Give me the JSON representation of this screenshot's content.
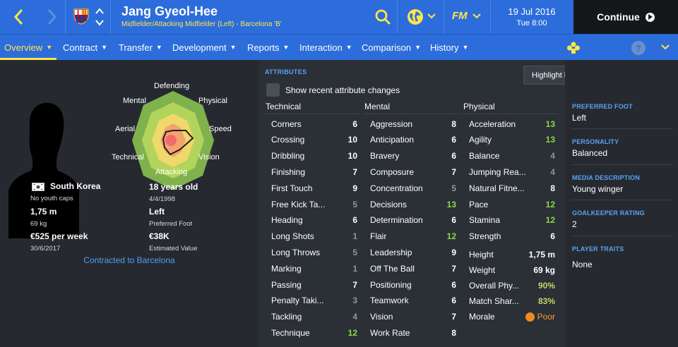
{
  "header": {
    "player_name": "Jang Gyeol-Hee",
    "player_subtitle": "Midfielder/Attacking Midfielder (Left) - Barcelona 'B'",
    "game_logo": "FM",
    "date": "19 Jul 2016",
    "time": "Tue 8:00",
    "continue_label": "Continue",
    "icons": [
      "back-arrow-icon",
      "forward-arrow-icon",
      "club-crest-icon",
      "up-down-icon",
      "search-icon",
      "globe-icon",
      "chevron-down-icon",
      "play-icon"
    ],
    "accent_color": "#2d6ddb",
    "highlight_color": "#ffe64a"
  },
  "subnav": {
    "tabs": [
      {
        "label": "Overview"
      },
      {
        "label": "Contract"
      },
      {
        "label": "Transfer"
      },
      {
        "label": "Development"
      },
      {
        "label": "Reports"
      },
      {
        "label": "Interaction"
      },
      {
        "label": "Comparison"
      },
      {
        "label": "History"
      }
    ],
    "active_tab": "Overview",
    "help_label": "?",
    "icons": [
      "trophy-icon",
      "help-icon",
      "chevron-down-icon"
    ]
  },
  "radar": {
    "labels": {
      "defending": "Defending",
      "physical": "Physical",
      "speed": "Speed",
      "vision": "Vision",
      "attacking": "Attacking",
      "technical": "Technical",
      "aerial": "Aerial",
      "mental": "Mental"
    }
  },
  "bio": {
    "nationality": "South Korea",
    "youth_caps": "No youth caps",
    "height": "1,75 m",
    "weight": "69 kg",
    "wage": "€525 per week",
    "contract_end": "30/6/2017",
    "age": "18 years old",
    "dob": "4/4/1998",
    "foot": "Left",
    "foot_label": "Preferred Foot",
    "value": "€38K",
    "value_label": "Estimated Value",
    "contracted": "Contracted to Barcelona"
  },
  "attributes": {
    "title": "ATTRIBUTES",
    "highlight_dropdown": "Highlight key attributes for role",
    "show_recent_label": "Show recent attribute changes",
    "columns": [
      {
        "heading": "Technical",
        "items": [
          {
            "name": "Corners",
            "value": "6",
            "tier": "good"
          },
          {
            "name": "Crossing",
            "value": "10",
            "tier": "good"
          },
          {
            "name": "Dribbling",
            "value": "10",
            "tier": "good"
          },
          {
            "name": "Finishing",
            "value": "7",
            "tier": "good"
          },
          {
            "name": "First Touch",
            "value": "9",
            "tier": "good"
          },
          {
            "name": "Free Kick Ta...",
            "value": "5",
            "tier": "avg"
          },
          {
            "name": "Heading",
            "value": "6",
            "tier": "good"
          },
          {
            "name": "Long Shots",
            "value": "1",
            "tier": "avg"
          },
          {
            "name": "Long Throws",
            "value": "5",
            "tier": "avg"
          },
          {
            "name": "Marking",
            "value": "1",
            "tier": "avg"
          },
          {
            "name": "Passing",
            "value": "7",
            "tier": "good"
          },
          {
            "name": "Penalty Taki...",
            "value": "3",
            "tier": "avg"
          },
          {
            "name": "Tackling",
            "value": "4",
            "tier": "avg"
          },
          {
            "name": "Technique",
            "value": "12",
            "tier": "high"
          }
        ]
      },
      {
        "heading": "Mental",
        "items": [
          {
            "name": "Aggression",
            "value": "8",
            "tier": "good"
          },
          {
            "name": "Anticipation",
            "value": "6",
            "tier": "good"
          },
          {
            "name": "Bravery",
            "value": "6",
            "tier": "good"
          },
          {
            "name": "Composure",
            "value": "7",
            "tier": "good"
          },
          {
            "name": "Concentration",
            "value": "5",
            "tier": "avg"
          },
          {
            "name": "Decisions",
            "value": "13",
            "tier": "high"
          },
          {
            "name": "Determination",
            "value": "6",
            "tier": "good"
          },
          {
            "name": "Flair",
            "value": "12",
            "tier": "high"
          },
          {
            "name": "Leadership",
            "value": "9",
            "tier": "good"
          },
          {
            "name": "Off The Ball",
            "value": "7",
            "tier": "good"
          },
          {
            "name": "Positioning",
            "value": "6",
            "tier": "good"
          },
          {
            "name": "Teamwork",
            "value": "6",
            "tier": "good"
          },
          {
            "name": "Vision",
            "value": "7",
            "tier": "good"
          },
          {
            "name": "Work Rate",
            "value": "8",
            "tier": "good"
          }
        ]
      },
      {
        "heading": "Physical",
        "items": [
          {
            "name": "Acceleration",
            "value": "13",
            "tier": "high"
          },
          {
            "name": "Agility",
            "value": "13",
            "tier": "high"
          },
          {
            "name": "Balance",
            "value": "4",
            "tier": "avg"
          },
          {
            "name": "Jumping Rea...",
            "value": "4",
            "tier": "avg"
          },
          {
            "name": "Natural Fitne...",
            "value": "8",
            "tier": "good"
          },
          {
            "name": "Pace",
            "value": "12",
            "tier": "high"
          },
          {
            "name": "Stamina",
            "value": "12",
            "tier": "high"
          },
          {
            "name": "Strength",
            "value": "6",
            "tier": "good"
          }
        ]
      }
    ],
    "physical_extra": [
      {
        "name": "Height",
        "value": "1,75 m",
        "kind": "plain"
      },
      {
        "name": "Weight",
        "value": "69 kg",
        "kind": "plain"
      },
      {
        "name": "Overall Phy...",
        "value": "90%",
        "kind": "pct"
      },
      {
        "name": "Match Shar...",
        "value": "83%",
        "kind": "pct"
      },
      {
        "name": "Morale",
        "value": "Poor",
        "kind": "poor"
      }
    ],
    "tier_colors": {
      "avg": "#8f949c",
      "good": "#ffffff",
      "high": "#8ed846"
    }
  },
  "info": {
    "preferred_foot_title": "PREFERRED FOOT",
    "preferred_foot": "Left",
    "personality_title": "PERSONALITY",
    "personality": "Balanced",
    "media_title": "MEDIA DESCRIPTION",
    "media": "Young winger",
    "gk_title": "GOALKEEPER RATING",
    "gk": "2",
    "traits_title": "PLAYER TRAITS",
    "traits": "None"
  }
}
